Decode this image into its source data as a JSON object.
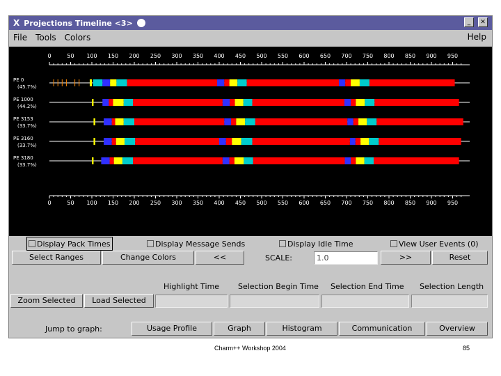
{
  "window": {
    "title": "Projections Timeline <3>",
    "menu": [
      "File",
      "Tools",
      "Colors"
    ],
    "help": "Help"
  },
  "colors": {
    "timeline_bg": "#000000",
    "busy": "#ff0000",
    "blue": "#3030ff",
    "yellow": "#ffff00",
    "teal": "#00cccc",
    "axis": "#ffffff",
    "label": "#ffffff"
  },
  "timeline": {
    "ticks": [
      0,
      50,
      100,
      150,
      200,
      250,
      300,
      350,
      400,
      450,
      500,
      550,
      600,
      650,
      700,
      750,
      800,
      850,
      900,
      950
    ],
    "processors": [
      {
        "label": "PE 0",
        "util": "(45.7%)"
      },
      {
        "label": "PE 1000",
        "util": "(44.2%)"
      },
      {
        "label": "PE 3153",
        "util": "(33.7%)"
      },
      {
        "label": "PE 3160",
        "util": "(33.7%)"
      },
      {
        "label": "PE 3180",
        "util": "(33.7%)"
      }
    ],
    "rows": [
      {
        "segments": [
          {
            "start": 95,
            "end": 100,
            "color": "yellow"
          },
          {
            "start": 103,
            "end": 125,
            "color": "teal"
          },
          {
            "start": 125,
            "end": 143,
            "color": "blue"
          },
          {
            "start": 143,
            "end": 158,
            "color": "yellow"
          },
          {
            "start": 158,
            "end": 183,
            "color": "teal"
          },
          {
            "start": 183,
            "end": 395,
            "color": "busy"
          },
          {
            "start": 395,
            "end": 412,
            "color": "blue"
          },
          {
            "start": 412,
            "end": 424,
            "color": "busy"
          },
          {
            "start": 424,
            "end": 443,
            "color": "yellow"
          },
          {
            "start": 443,
            "end": 465,
            "color": "teal"
          },
          {
            "start": 465,
            "end": 682,
            "color": "busy"
          },
          {
            "start": 682,
            "end": 697,
            "color": "blue"
          },
          {
            "start": 697,
            "end": 710,
            "color": "busy"
          },
          {
            "start": 710,
            "end": 731,
            "color": "yellow"
          },
          {
            "start": 731,
            "end": 754,
            "color": "teal"
          },
          {
            "start": 754,
            "end": 955,
            "color": "busy"
          }
        ]
      },
      {
        "segments": [
          {
            "start": 100,
            "end": 104,
            "color": "yellow"
          },
          {
            "start": 125,
            "end": 140,
            "color": "blue"
          },
          {
            "start": 140,
            "end": 150,
            "color": "busy"
          },
          {
            "start": 150,
            "end": 175,
            "color": "yellow"
          },
          {
            "start": 175,
            "end": 197,
            "color": "teal"
          },
          {
            "start": 197,
            "end": 408,
            "color": "busy"
          },
          {
            "start": 408,
            "end": 425,
            "color": "blue"
          },
          {
            "start": 425,
            "end": 437,
            "color": "busy"
          },
          {
            "start": 437,
            "end": 457,
            "color": "yellow"
          },
          {
            "start": 457,
            "end": 478,
            "color": "teal"
          },
          {
            "start": 478,
            "end": 695,
            "color": "busy"
          },
          {
            "start": 695,
            "end": 710,
            "color": "blue"
          },
          {
            "start": 710,
            "end": 722,
            "color": "busy"
          },
          {
            "start": 722,
            "end": 743,
            "color": "yellow"
          },
          {
            "start": 743,
            "end": 766,
            "color": "teal"
          },
          {
            "start": 766,
            "end": 965,
            "color": "busy"
          }
        ]
      },
      {
        "segments": [
          {
            "start": 104,
            "end": 108,
            "color": "yellow"
          },
          {
            "start": 128,
            "end": 147,
            "color": "blue"
          },
          {
            "start": 147,
            "end": 155,
            "color": "busy"
          },
          {
            "start": 155,
            "end": 175,
            "color": "yellow"
          },
          {
            "start": 175,
            "end": 200,
            "color": "teal"
          },
          {
            "start": 200,
            "end": 412,
            "color": "busy"
          },
          {
            "start": 412,
            "end": 428,
            "color": "blue"
          },
          {
            "start": 428,
            "end": 440,
            "color": "busy"
          },
          {
            "start": 440,
            "end": 461,
            "color": "yellow"
          },
          {
            "start": 461,
            "end": 485,
            "color": "teal"
          },
          {
            "start": 485,
            "end": 702,
            "color": "busy"
          },
          {
            "start": 702,
            "end": 716,
            "color": "blue"
          },
          {
            "start": 716,
            "end": 728,
            "color": "busy"
          },
          {
            "start": 728,
            "end": 748,
            "color": "yellow"
          },
          {
            "start": 748,
            "end": 771,
            "color": "teal"
          },
          {
            "start": 771,
            "end": 975,
            "color": "busy"
          }
        ]
      },
      {
        "segments": [
          {
            "start": 104,
            "end": 108,
            "color": "yellow"
          },
          {
            "start": 128,
            "end": 147,
            "color": "blue"
          },
          {
            "start": 147,
            "end": 157,
            "color": "busy"
          },
          {
            "start": 157,
            "end": 177,
            "color": "yellow"
          },
          {
            "start": 177,
            "end": 202,
            "color": "teal"
          },
          {
            "start": 202,
            "end": 400,
            "color": "busy"
          },
          {
            "start": 400,
            "end": 416,
            "color": "blue"
          },
          {
            "start": 416,
            "end": 430,
            "color": "busy"
          },
          {
            "start": 430,
            "end": 452,
            "color": "yellow"
          },
          {
            "start": 452,
            "end": 478,
            "color": "teal"
          },
          {
            "start": 478,
            "end": 708,
            "color": "busy"
          },
          {
            "start": 708,
            "end": 721,
            "color": "blue"
          },
          {
            "start": 721,
            "end": 733,
            "color": "busy"
          },
          {
            "start": 733,
            "end": 753,
            "color": "yellow"
          },
          {
            "start": 753,
            "end": 776,
            "color": "teal"
          },
          {
            "start": 776,
            "end": 970,
            "color": "busy"
          }
        ]
      },
      {
        "segments": [
          {
            "start": 100,
            "end": 104,
            "color": "yellow"
          },
          {
            "start": 122,
            "end": 142,
            "color": "blue"
          },
          {
            "start": 142,
            "end": 152,
            "color": "busy"
          },
          {
            "start": 152,
            "end": 172,
            "color": "yellow"
          },
          {
            "start": 172,
            "end": 197,
            "color": "teal"
          },
          {
            "start": 197,
            "end": 408,
            "color": "busy"
          },
          {
            "start": 408,
            "end": 424,
            "color": "blue"
          },
          {
            "start": 424,
            "end": 436,
            "color": "busy"
          },
          {
            "start": 436,
            "end": 458,
            "color": "yellow"
          },
          {
            "start": 458,
            "end": 480,
            "color": "teal"
          },
          {
            "start": 480,
            "end": 696,
            "color": "busy"
          },
          {
            "start": 696,
            "end": 710,
            "color": "blue"
          },
          {
            "start": 710,
            "end": 722,
            "color": "busy"
          },
          {
            "start": 722,
            "end": 742,
            "color": "yellow"
          },
          {
            "start": 742,
            "end": 764,
            "color": "teal"
          },
          {
            "start": 764,
            "end": 965,
            "color": "busy"
          }
        ]
      }
    ]
  },
  "checkboxes": {
    "pack": "Display Pack Times",
    "msg": "Display Message Sends",
    "idle": "Display Idle Time",
    "user": "View User Events (0)"
  },
  "controls": {
    "select_ranges": "Select Ranges",
    "change_colors": "Change Colors",
    "zoom_out": "<<",
    "scale_label": "SCALE:",
    "scale_value": "1.0",
    "zoom_in": ">>",
    "reset": "Reset"
  },
  "selection": {
    "highlight_time": "Highlight Time",
    "selection_begin": "Selection Begin Time",
    "selection_end": "Selection End Time",
    "selection_length": "Selection Length",
    "zoom_selected": "Zoom Selected",
    "load_selected": "Load Selected"
  },
  "jump": {
    "label": "Jump to graph:",
    "buttons": [
      "Usage Profile",
      "Graph",
      "Histogram",
      "Communication",
      "Overview"
    ]
  },
  "footer": {
    "text": "Charm++ Workshop 2004",
    "page": "85"
  }
}
